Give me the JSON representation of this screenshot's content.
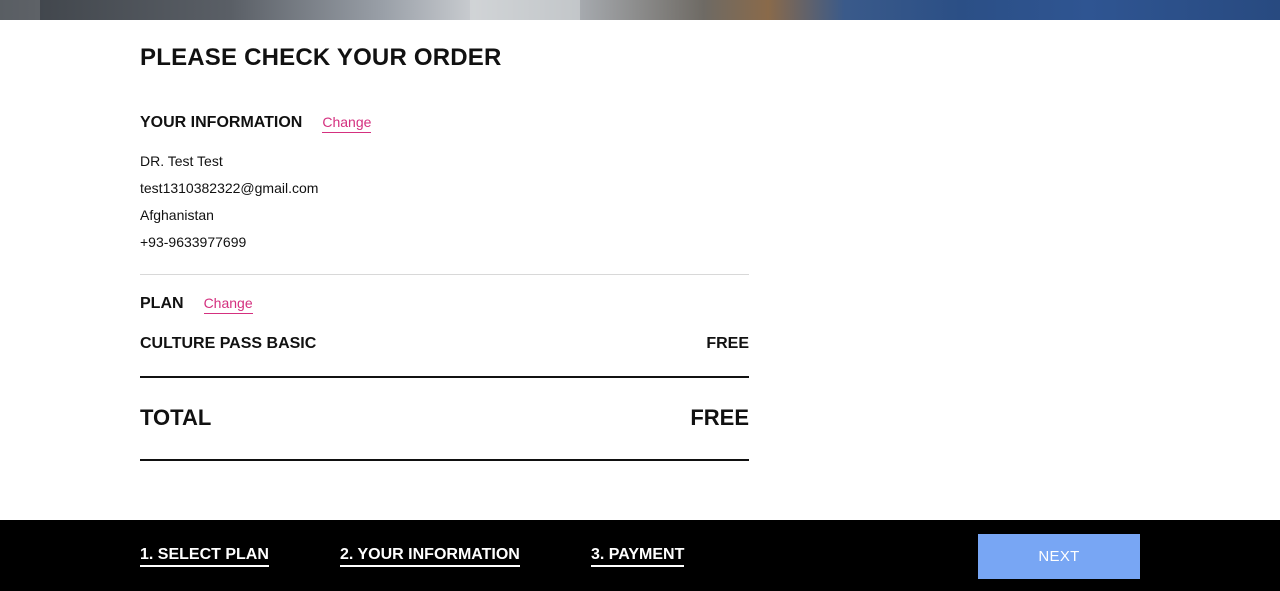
{
  "page": {
    "title": "PLEASE CHECK YOUR ORDER"
  },
  "your_information": {
    "heading": "YOUR INFORMATION",
    "change_label": "Change",
    "name": "DR. Test Test",
    "email": "test1310382322@gmail.com",
    "country": "Afghanistan",
    "phone": "+93-9633977699"
  },
  "plan": {
    "heading": "PLAN",
    "change_label": "Change",
    "name": "CULTURE PASS BASIC",
    "price": "FREE"
  },
  "total": {
    "label": "TOTAL",
    "value": "FREE"
  },
  "footer": {
    "steps": [
      {
        "label": "1. SELECT PLAN"
      },
      {
        "label": "2. YOUR INFORMATION"
      },
      {
        "label": "3. PAYMENT"
      }
    ],
    "next_label": "NEXT"
  },
  "colors": {
    "accent_link": "#d4307f",
    "next_button_bg": "#78a6f4",
    "footer_bg": "#000000",
    "text": "#111111"
  }
}
